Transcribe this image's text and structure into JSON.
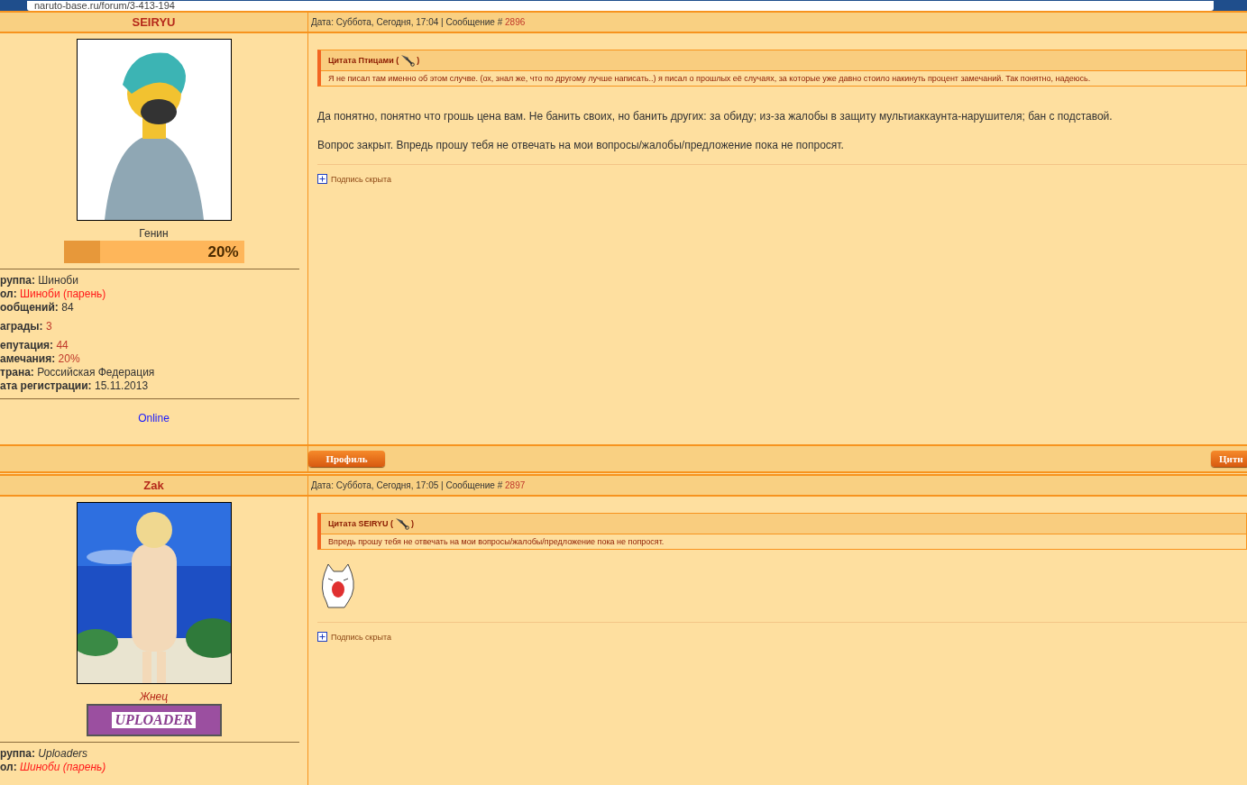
{
  "address_bar": {
    "url": "naruto-base.ru/forum/3-413-194"
  },
  "posts": [
    {
      "author": "SEIRYU",
      "date_text": "Дата: Суббота, Сегодня, 17:04 | Сообщение #",
      "number": "2896",
      "avatar": {
        "kind": "picture"
      },
      "rank": {
        "text": "Генин",
        "kind": "plain"
      },
      "rank_bar": {
        "level": 0.2,
        "label": "20%"
      },
      "stat_groups": [
        [
          {
            "label": "руппа:",
            "value": "Шиноби",
            "color": "#333333"
          },
          {
            "label": "ол:",
            "value": "Шиноби (парень)",
            "color": "#ff1a1a"
          },
          {
            "label": "ообщений:",
            "value": "84",
            "color": "#333333"
          }
        ],
        [
          {
            "label": "аграды:",
            "value": "3",
            "color": "#c0392b"
          }
        ],
        [
          {
            "label": "епутация:",
            "value": "44",
            "color": "#c0392b"
          },
          {
            "label": "амечания:",
            "value": "20%",
            "color": "#c0392b"
          },
          {
            "label": "трана:",
            "value": "Российская Федерация",
            "color": "#333333"
          },
          {
            "label": "ата регистрации:",
            "value": "15.11.2013",
            "color": "#333333"
          }
        ]
      ],
      "italic_stats": false,
      "status": "Online",
      "quote": {
        "title": "Цитата Птицами (",
        "close": ")",
        "text": "Я не писал там именно об этом случве. (ох, знал же, что по другому лучше написать..) я писал о прошлых её случаях, за которые уже давно стоило накинуть процент замечаний. Так понятно, надеюсь."
      },
      "paragraphs": [
        "Да понятно, понятно что грошь цена вам. Не банить своих, но банить других: за обиду; из-за жалобы в защиту мультиаккаунта-нарушителя; бан с подставой.",
        "Вопрос закрыт. Впредь прошу тебя не отвечать на мои вопросы/жалобы/предложение пока не попросят."
      ],
      "smiley": false,
      "signature": "Подпись скрыта",
      "buttons": [
        {
          "label": "Профиль",
          "kind": "profile"
        },
        {
          "label": "Цитн",
          "kind": "quote"
        }
      ]
    },
    {
      "author": "Zak",
      "date_text": "Дата: Суббота, Сегодня, 17:05 | Сообщение #",
      "number": "2897",
      "avatar": {
        "kind": "picture"
      },
      "rank": {
        "text": "Жнец",
        "kind": "italic"
      },
      "badge": {
        "text": "UPLOADER"
      },
      "stat_groups": [
        [
          {
            "label": "руппа:",
            "value": "Uploaders",
            "color": "#333333"
          },
          {
            "label": "ол:",
            "value": "Шиноби (парень)",
            "color": "#ff1a1a"
          }
        ]
      ],
      "italic_stats": true,
      "quote": {
        "title": "Цитата SEIRYU (",
        "close": ")",
        "text": "Впредь прошу тебя не отвечать на мои вопросы/жалобы/предложение пока не попросят."
      },
      "smiley": true,
      "signature": "Подпись скрыта"
    }
  ]
}
